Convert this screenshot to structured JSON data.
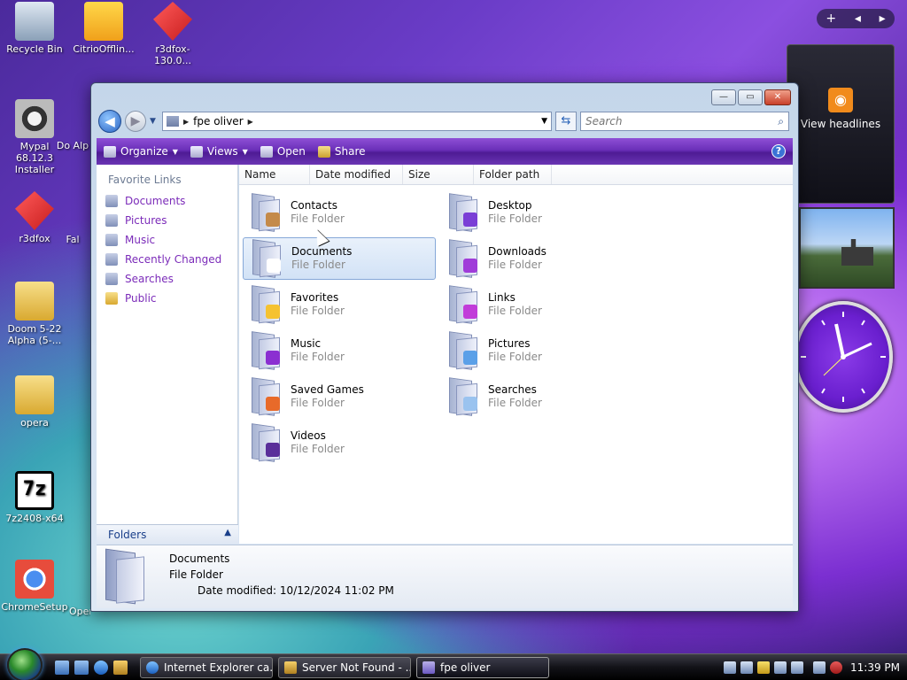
{
  "desktop": {
    "icons": [
      {
        "label": "Recycle Bin"
      },
      {
        "label": "CitrioOfflin..."
      },
      {
        "label": "r3dfox-130.0..."
      },
      {
        "label": "Mypal 68.12.3 Installer"
      },
      {
        "label": "Do Alp"
      },
      {
        "label": "r3dfox"
      },
      {
        "label": "Fal"
      },
      {
        "label": "Doom 5-22 Alpha (5-..."
      },
      {
        "label": "opera"
      },
      {
        "label": "7z2408-x64"
      },
      {
        "label": "ChromeSetup"
      },
      {
        "label": "OperaSetup"
      }
    ]
  },
  "gadgets": {
    "feed_label": "View headlines",
    "controls": [
      "+",
      "◂",
      "▸"
    ]
  },
  "window": {
    "title_buttons": {
      "minimize": "—",
      "maximize": "▭",
      "close": "✕"
    },
    "address": {
      "crumb": "fpe oliver"
    },
    "search": {
      "placeholder": "Search"
    },
    "toolbar": {
      "organize": "Organize",
      "views": "Views",
      "open": "Open",
      "share": "Share",
      "help": "?"
    },
    "nav": {
      "header": "Favorite Links",
      "links": [
        "Documents",
        "Pictures",
        "Music",
        "Recently Changed",
        "Searches",
        "Public"
      ],
      "folders": "Folders"
    },
    "columns": [
      "Name",
      "Date modified",
      "Size",
      "Folder path"
    ],
    "items": [
      {
        "name": "Contacts",
        "type": "File Folder",
        "accent": "#c48a4a"
      },
      {
        "name": "Desktop",
        "type": "File Folder",
        "accent": "#7a3fd6"
      },
      {
        "name": "Documents",
        "type": "File Folder",
        "accent": "#ffffff"
      },
      {
        "name": "Downloads",
        "type": "File Folder",
        "accent": "#a03cd9"
      },
      {
        "name": "Favorites",
        "type": "File Folder",
        "accent": "#f5c231"
      },
      {
        "name": "Links",
        "type": "File Folder",
        "accent": "#c13cd9"
      },
      {
        "name": "Music",
        "type": "File Folder",
        "accent": "#8b2fd1"
      },
      {
        "name": "Pictures",
        "type": "File Folder",
        "accent": "#5aa0e8"
      },
      {
        "name": "Saved Games",
        "type": "File Folder",
        "accent": "#e86a2a"
      },
      {
        "name": "Searches",
        "type": "File Folder",
        "accent": "#9ac3ef"
      },
      {
        "name": "Videos",
        "type": "File Folder",
        "accent": "#5a2f9a"
      }
    ],
    "details": {
      "name": "Documents",
      "type": "File Folder",
      "date_label": "Date modified:",
      "date_value": "10/12/2024 11:02 PM"
    }
  },
  "taskbar": {
    "tasks": [
      "Internet Explorer ca...",
      "Server Not Found - ...",
      "fpe oliver"
    ],
    "clock": "11:39 PM"
  }
}
